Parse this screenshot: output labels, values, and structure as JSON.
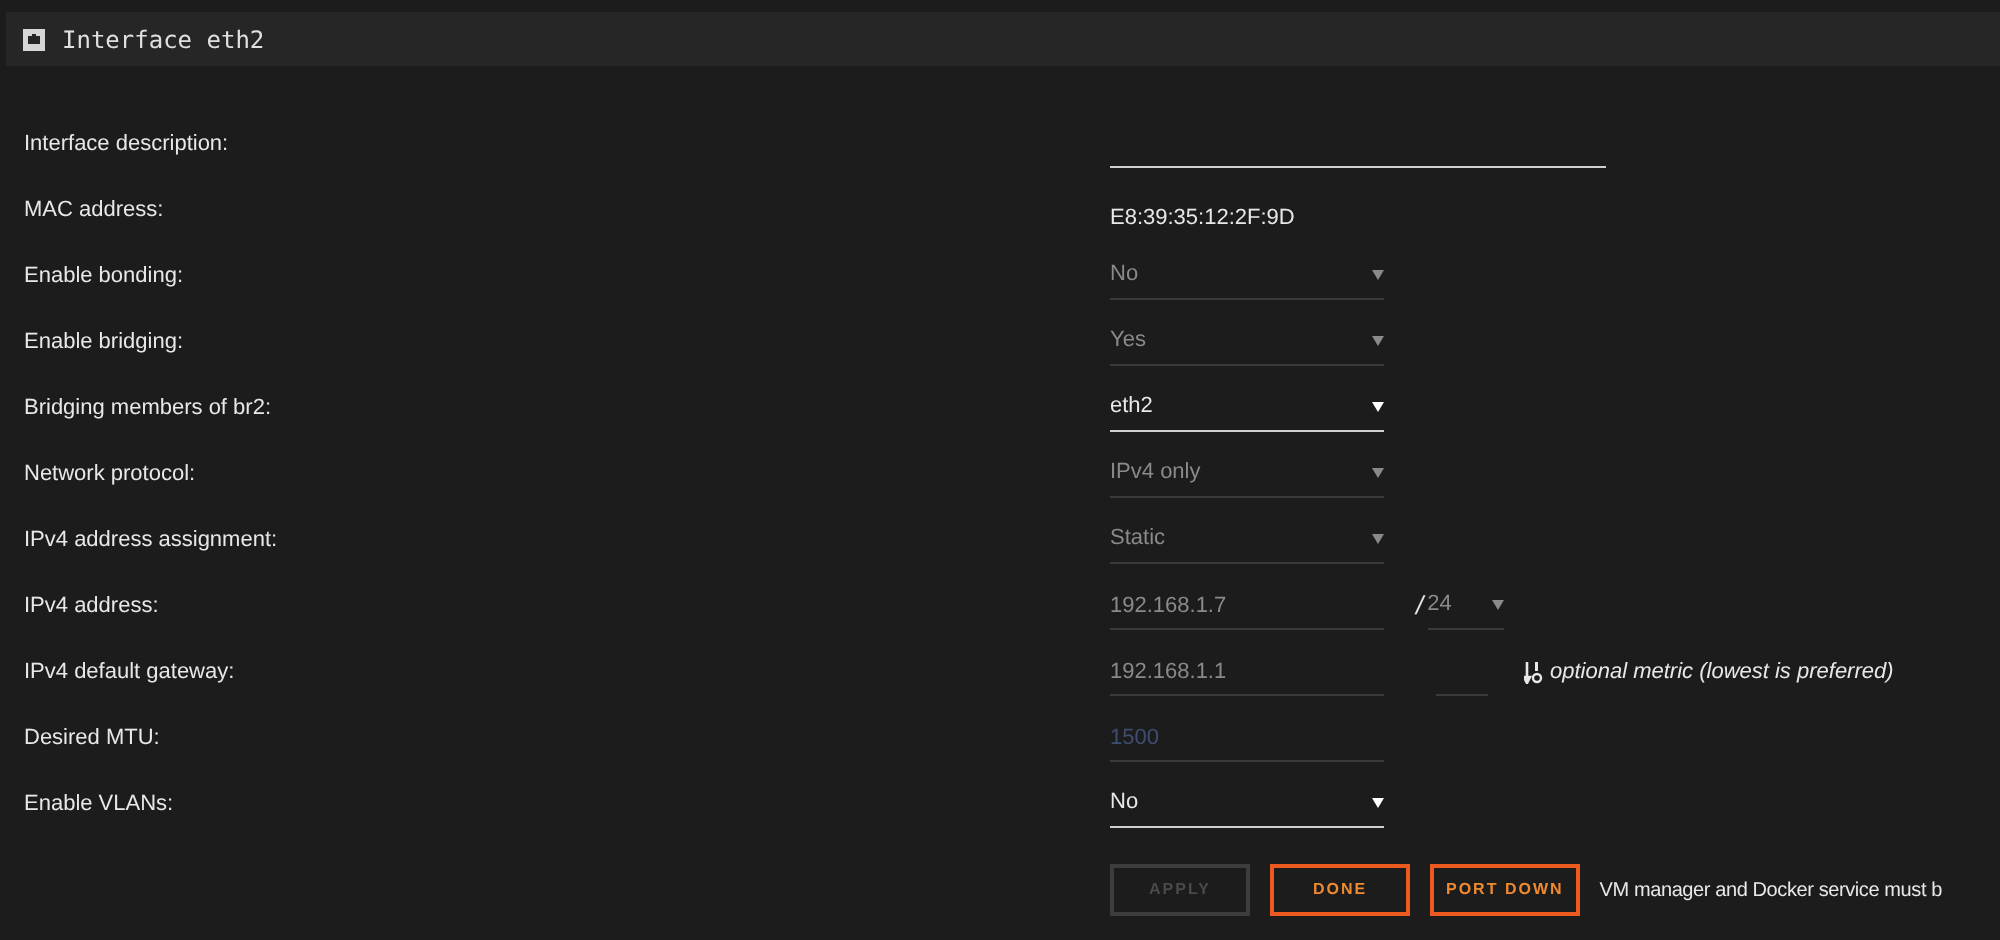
{
  "panel": {
    "title": "Interface eth2"
  },
  "rows": [
    {
      "kind": "text",
      "label": "Interface description:",
      "value": ""
    },
    {
      "kind": "static",
      "label": "MAC address:",
      "value": "E8:39:35:12:2F:9D"
    },
    {
      "kind": "select",
      "label": "Enable bonding:",
      "value": "No",
      "disabled": true
    },
    {
      "kind": "select",
      "label": "Enable bridging:",
      "value": "Yes",
      "disabled": true
    },
    {
      "kind": "select",
      "label": "Bridging members of br2:",
      "value": "eth2",
      "disabled": false
    },
    {
      "kind": "select",
      "label": "Network protocol:",
      "value": "IPv4 only",
      "disabled": true
    },
    {
      "kind": "select",
      "label": "IPv4 address assignment:",
      "value": "Static",
      "disabled": true
    },
    {
      "kind": "prefix",
      "label": "IPv4 address:",
      "value": "192.168.1.7",
      "disabled": true,
      "separator": "/",
      "prefix": "24"
    },
    {
      "kind": "metric",
      "label": "IPv4 default gateway:",
      "value": "192.168.1.1",
      "disabled": true,
      "hint": "optional metric (lowest is preferred)"
    },
    {
      "kind": "number",
      "label": "Desired MTU:",
      "placeholder": "1500",
      "disabled": true
    },
    {
      "kind": "select",
      "label": "Enable VLANs:",
      "value": "No",
      "disabled": false
    }
  ],
  "buttons": [
    {
      "label": "APPLY",
      "disabled": true
    },
    {
      "label": "DONE",
      "disabled": false
    },
    {
      "label": "PORT DOWN",
      "disabled": false
    }
  ],
  "notice": "VM manager and Docker service must b"
}
